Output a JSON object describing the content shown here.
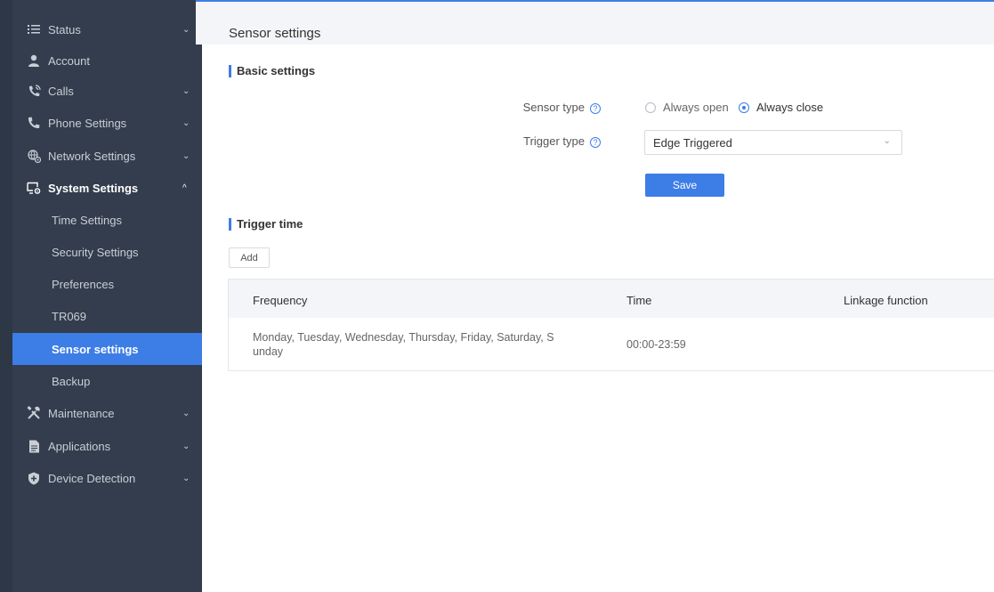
{
  "sidebar": {
    "items": [
      {
        "label": "Status",
        "icon": "list-icon",
        "has_chevron": true
      },
      {
        "label": "Account",
        "icon": "user-icon",
        "has_chevron": false
      },
      {
        "label": "Calls",
        "icon": "phone-call-icon",
        "has_chevron": true
      },
      {
        "label": "Phone Settings",
        "icon": "phone-icon",
        "has_chevron": true
      },
      {
        "label": "Network Settings",
        "icon": "network-globe-icon",
        "has_chevron": true
      },
      {
        "label": "System Settings",
        "icon": "system-monitor-gear-icon",
        "has_chevron": true,
        "expanded": true
      },
      {
        "label": "Maintenance",
        "icon": "tools-icon",
        "has_chevron": true
      },
      {
        "label": "Applications",
        "icon": "document-icon",
        "has_chevron": true
      },
      {
        "label": "Device Detection",
        "icon": "shield-plus-icon",
        "has_chevron": true
      }
    ],
    "sub_items": [
      {
        "label": "Time Settings"
      },
      {
        "label": "Security Settings"
      },
      {
        "label": "Preferences"
      },
      {
        "label": "TR069"
      },
      {
        "label": "Sensor settings",
        "active": true
      },
      {
        "label": "Backup"
      }
    ],
    "chevron_down": "⌄",
    "chevron_up": "^"
  },
  "page": {
    "title": "Sensor settings"
  },
  "basic": {
    "section_title": "Basic settings",
    "sensor_type_label": "Sensor type",
    "sensor_type_options": [
      "Always open",
      "Always close"
    ],
    "sensor_type_selected": "Always close",
    "trigger_type_label": "Trigger type",
    "trigger_type_value": "Edge Triggered",
    "help_glyph": "?",
    "save_label": "Save"
  },
  "trigger_time": {
    "section_title": "Trigger time",
    "add_label": "Add",
    "columns": [
      "Frequency",
      "Time",
      "Linkage function"
    ],
    "rows": [
      {
        "frequency_line1": "Monday, Tuesday, Wednesday, Thursday, Friday, Saturday, S",
        "frequency_line2": "unday",
        "time": "00:00-23:59",
        "linkage": ""
      }
    ]
  },
  "colors": {
    "accent": "#3d7de6",
    "sidebar_bg": "#333d4d",
    "header_bg": "#f3f5f8"
  }
}
